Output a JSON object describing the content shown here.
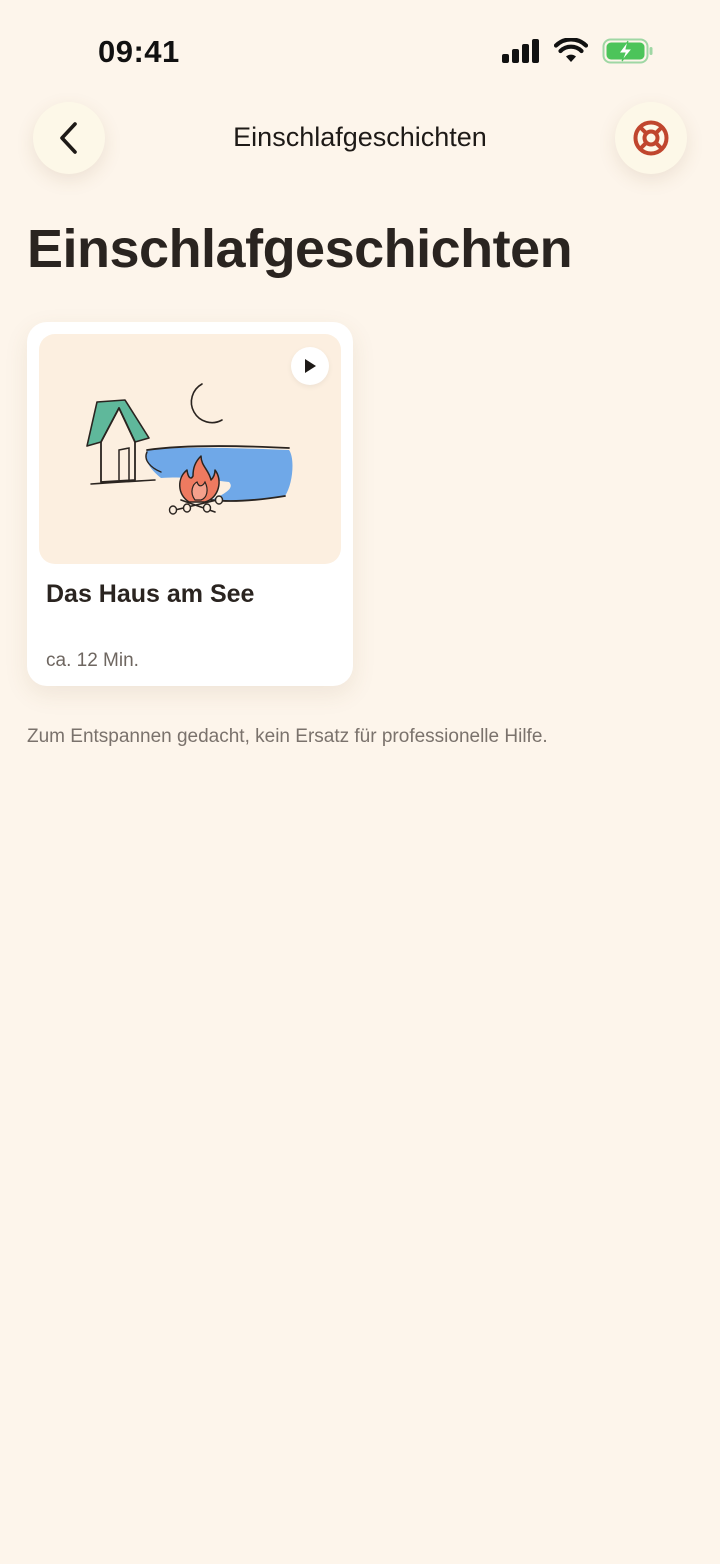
{
  "status_bar": {
    "time": "09:41"
  },
  "nav": {
    "title": "Einschlafgeschichten",
    "back_icon": "chevron-left-icon",
    "help_icon": "lifebuoy-icon"
  },
  "page": {
    "title": "Einschlafgeschichten",
    "disclaimer": "Zum Entspannen gedacht, kein Ersatz für professionelle Hilfe."
  },
  "stories": [
    {
      "title": "Das Haus am See",
      "duration": "ca. 12 Min.",
      "illustration": "house-lake-campfire-moon",
      "play_icon": "play-icon"
    }
  ],
  "colors": {
    "background": "#fdf5eb",
    "accent_red": "#c0462e",
    "card_image_bg": "#fcefe0",
    "lake_blue": "#6fa8e8",
    "roof_teal": "#5fb89b",
    "moon_yellow": "#f2b94a",
    "battery_green": "#4cc45a"
  }
}
